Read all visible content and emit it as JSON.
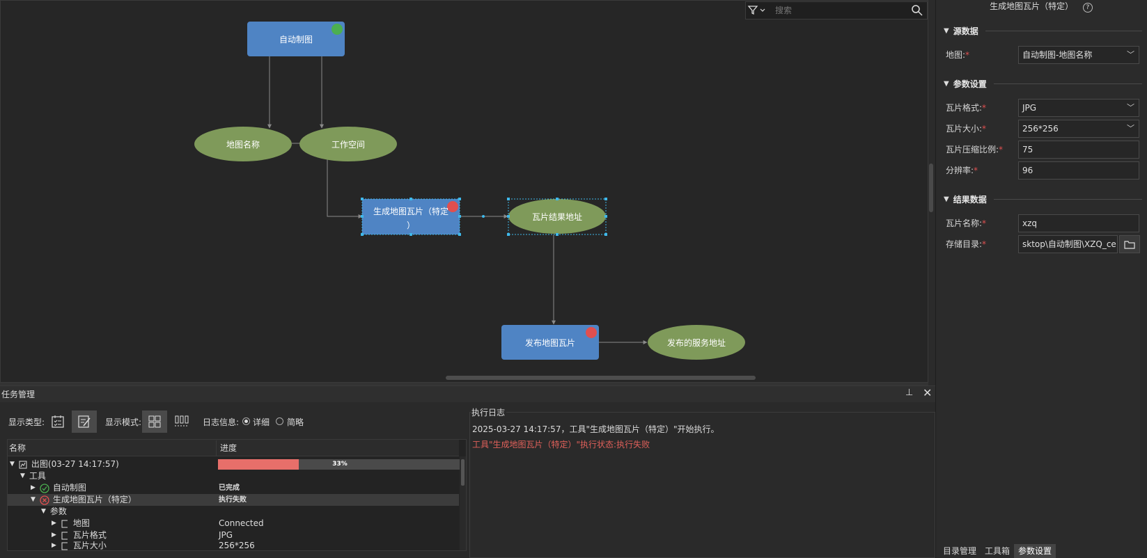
{
  "canvas": {
    "nodes": {
      "auto_map": "自动制图",
      "map_name": "地图名称",
      "workspace": "工作空间",
      "gen_tile_line1": "生成地图瓦片（特定",
      "gen_tile_line2": "）",
      "tile_result": "瓦片结果地址",
      "publish": "发布地图瓦片",
      "service_addr": "发布的服务地址"
    },
    "colors": {
      "rect": "#4f84c4",
      "ellipse": "#7f9a5a",
      "green_dot": "#4caf50",
      "red_dot": "#e04f4f",
      "handle": "#3fb8ea",
      "edge": "#8a8a8a"
    }
  },
  "search": {
    "placeholder": "搜索"
  },
  "right_panel": {
    "title": "生成地图瓦片（特定）",
    "help_icon": "help-icon",
    "source": {
      "header": "源数据",
      "map_label": "地图:",
      "map_value": "自动制图-地图名称"
    },
    "params": {
      "header": "参数设置",
      "format_label": "瓦片格式:",
      "format_value": "JPG",
      "size_label": "瓦片大小:",
      "size_value": "256*256",
      "compress_label": "瓦片压缩比例:",
      "compress_value": "75",
      "dpi_label": "分辨率:",
      "dpi_value": "96"
    },
    "result": {
      "header": "结果数据",
      "name_label": "瓦片名称:",
      "name_value": "xzq",
      "dir_label": "存储目录:",
      "dir_value": "sktop\\自动制图\\XZQ_cel"
    },
    "required_mark": "*",
    "tabs": [
      "目录管理",
      "工具箱",
      "参数设置"
    ]
  },
  "task": {
    "title": "任务管理",
    "display_type_label": "显示类型:",
    "display_mode_label": "显示模式:",
    "log_info_label": "日志信息:",
    "log_detail": "详细",
    "log_brief": "简略",
    "columns": {
      "name": "名称",
      "progress": "进度"
    },
    "rows": {
      "job": "出图(03-27 14:17:57)",
      "tools": "工具",
      "tool1": "自动制图",
      "tool1_status": "已完成",
      "tool2": "生成地图瓦片（特定）",
      "tool2_status": "执行失败",
      "params": "参数",
      "p_map": "地图",
      "p_map_val": "Connected",
      "p_format": "瓦片格式",
      "p_format_val": "JPG",
      "p_size": "瓦片大小",
      "p_size_val": "256*256"
    },
    "progress": {
      "value": 33,
      "label": "33%"
    }
  },
  "log": {
    "title": "执行日志",
    "line1": "2025-03-27 14:17:57，工具\"生成地图瓦片（特定）\"开始执行。",
    "line2": "工具\"生成地图瓦片（特定）\"执行状态:执行失败",
    "error_color": "#e0605a"
  }
}
